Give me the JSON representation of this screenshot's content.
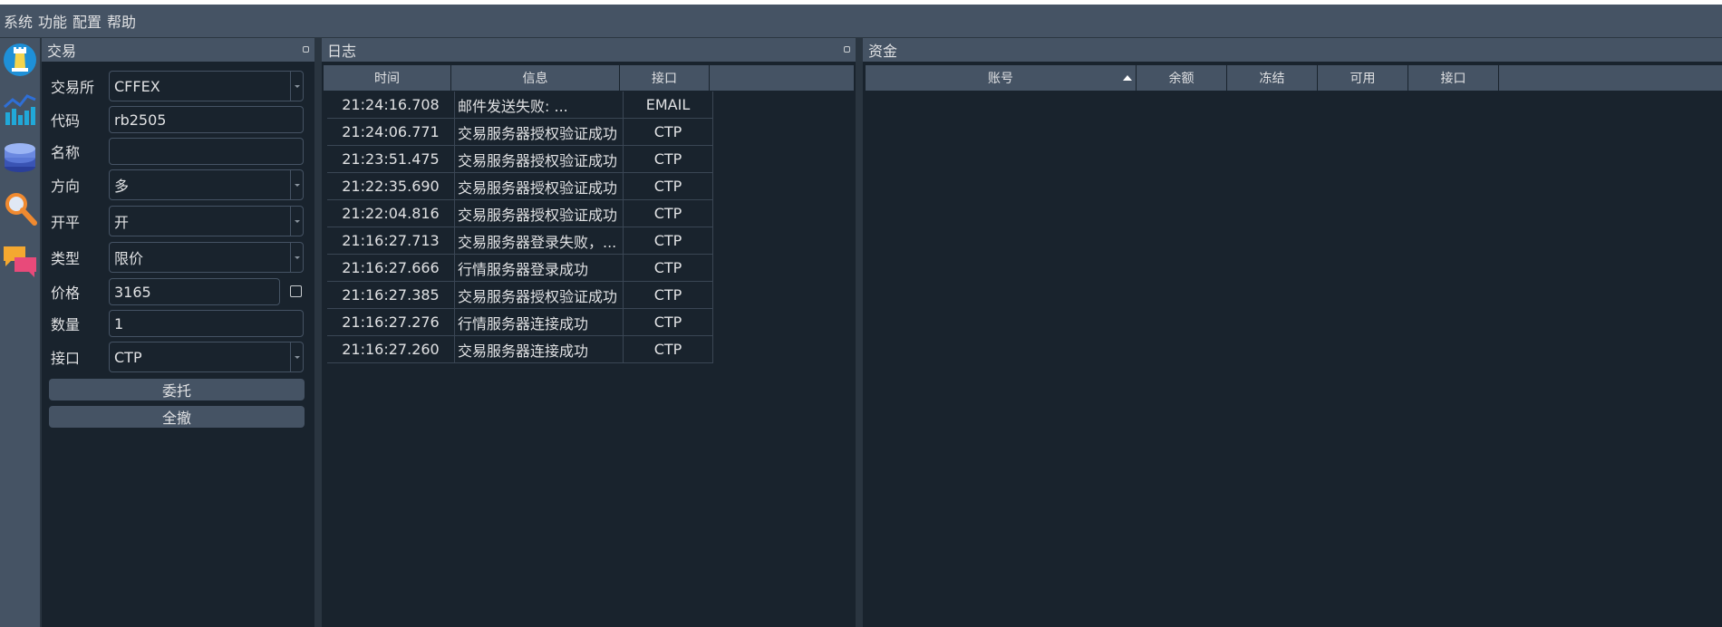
{
  "menu": [
    "系统",
    "功能",
    "配置",
    "帮助"
  ],
  "toolbar": {
    "icons": [
      "chess-rook-icon",
      "chart-icon",
      "database-icon",
      "magnifier-icon",
      "chat-icon"
    ]
  },
  "trading": {
    "title": "交易",
    "exchange_label": "交易所",
    "exchange_value": "CFFEX",
    "symbol_label": "代码",
    "symbol_value": "rb2505",
    "name_label": "名称",
    "name_value": "",
    "direction_label": "方向",
    "direction_value": "多",
    "offset_label": "开平",
    "offset_value": "开",
    "type_label": "类型",
    "type_value": "限价",
    "price_label": "价格",
    "price_value": "3165",
    "volume_label": "数量",
    "volume_value": "1",
    "gateway_label": "接口",
    "gateway_value": "CTP",
    "send_button": "委托",
    "cancel_all_button": "全撤"
  },
  "log": {
    "title": "日志",
    "columns": [
      "时间",
      "信息",
      "接口"
    ],
    "rows": [
      {
        "time": "21:24:16.708",
        "msg": "邮件发送失败: ...",
        "gateway": "EMAIL"
      },
      {
        "time": "21:24:06.771",
        "msg": "交易服务器授权验证成功",
        "gateway": "CTP"
      },
      {
        "time": "21:23:51.475",
        "msg": "交易服务器授权验证成功",
        "gateway": "CTP"
      },
      {
        "time": "21:22:35.690",
        "msg": "交易服务器授权验证成功",
        "gateway": "CTP"
      },
      {
        "time": "21:22:04.816",
        "msg": "交易服务器授权验证成功",
        "gateway": "CTP"
      },
      {
        "time": "21:16:27.713",
        "msg": "交易服务器登录失败，...",
        "gateway": "CTP"
      },
      {
        "time": "21:16:27.666",
        "msg": "行情服务器登录成功",
        "gateway": "CTP"
      },
      {
        "time": "21:16:27.385",
        "msg": "交易服务器授权验证成功",
        "gateway": "CTP"
      },
      {
        "time": "21:16:27.276",
        "msg": "行情服务器连接成功",
        "gateway": "CTP"
      },
      {
        "time": "21:16:27.260",
        "msg": "交易服务器连接成功",
        "gateway": "CTP"
      }
    ]
  },
  "account": {
    "title": "资金",
    "columns": [
      "账号",
      "余额",
      "冻结",
      "可用",
      "接口"
    ]
  }
}
